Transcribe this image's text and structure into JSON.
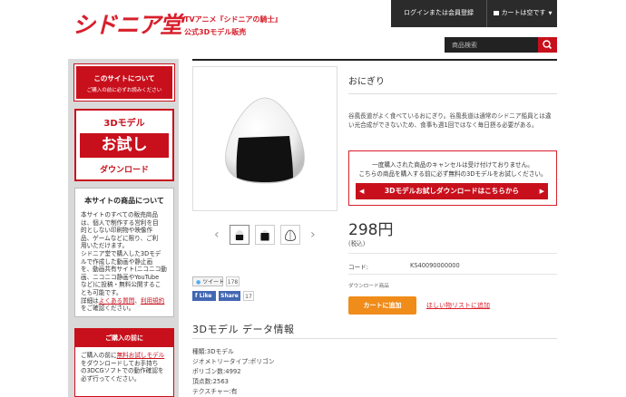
{
  "header": {
    "logo_text": "シドニア堂",
    "tagline_1": "TVアニメ『シドニアの騎士』",
    "tagline_2": "公式3Dモデル販売",
    "login_label": "ログインまたは会員登録",
    "cart_label": "カートは空です",
    "search_placeholder": "商品検索"
  },
  "sidebar": {
    "about_line1": "このサイトについて",
    "about_line2": "ご購入の前に必ずお読みください",
    "trial_row1": "3Dモデル",
    "trial_row2": "お試し",
    "trial_row3": "ダウンロード",
    "products_title": "本サイトの商品について",
    "products_lines": [
      "本サイトのすべての販売商品",
      "は、個人で制作する営利を目",
      "的としない印刷物や映像作",
      "品、ゲームなどに限り、ご利",
      "用いただけます。",
      "シドニア堂で購入した3Dモデ",
      "ルで作成した動画や静止画",
      "を、動画共有サイト(ニコニコ動",
      "画、ニコニコ静画やYouTube",
      "など)に投稿・無料公開するこ",
      "とも可能です。"
    ],
    "products_detail_prefix": "詳細は",
    "products_link1": "よくある質問",
    "products_sep": "、",
    "products_link2": "利用規約",
    "products_tail": "をご確認ください。",
    "before_title": "ご購入の前に",
    "before_prefix": "ご購入の前に",
    "before_link": "無料お試しモデル",
    "before_lines": [
      "をダウンロードしてお手持ち",
      "の3DCGソフトでの動作確認を",
      "必ず行ってください。"
    ]
  },
  "product": {
    "name": "おにぎり",
    "description": "谷風長道がよく食べているおにぎり。谷風長道は通常のシドニア船員とは違い光合成ができないため、食事も週1回ではなく毎日摂る必要がある。",
    "notice_line1": "一度購入された商品のキャンセルは受け付けておりません。",
    "notice_line2": "こちらの商品を購入する前に必ず無料の3Dモデルをお試しください。",
    "trial_cta": "3Dモデルお試しダウンロードはこちらから",
    "price": "298円",
    "tax": "(税込)",
    "code_label": "コード:",
    "code_value": "KS40090000000",
    "download_label": "ダウンロード商品",
    "cart_button": "カートに追加",
    "wishlist": "ほしい物リストに追加"
  },
  "social": {
    "tweet_label": "ツイート",
    "tweet_count": "178",
    "fb_like_label": "Like",
    "fb_share_label": "Share",
    "fb_count": "17"
  },
  "spec": {
    "title": "3Dモデル データ情報",
    "lines": [
      "種類:3Dモデル",
      "ジオメトリータイプ:ポリゴン",
      "ポリゴン数:4992",
      "頂点数:2563",
      "テクスチャー:有"
    ]
  },
  "colors": {
    "brand_red": "#c8101c",
    "cart_orange": "#f08c1a",
    "topbar": "#2b2b2b"
  }
}
